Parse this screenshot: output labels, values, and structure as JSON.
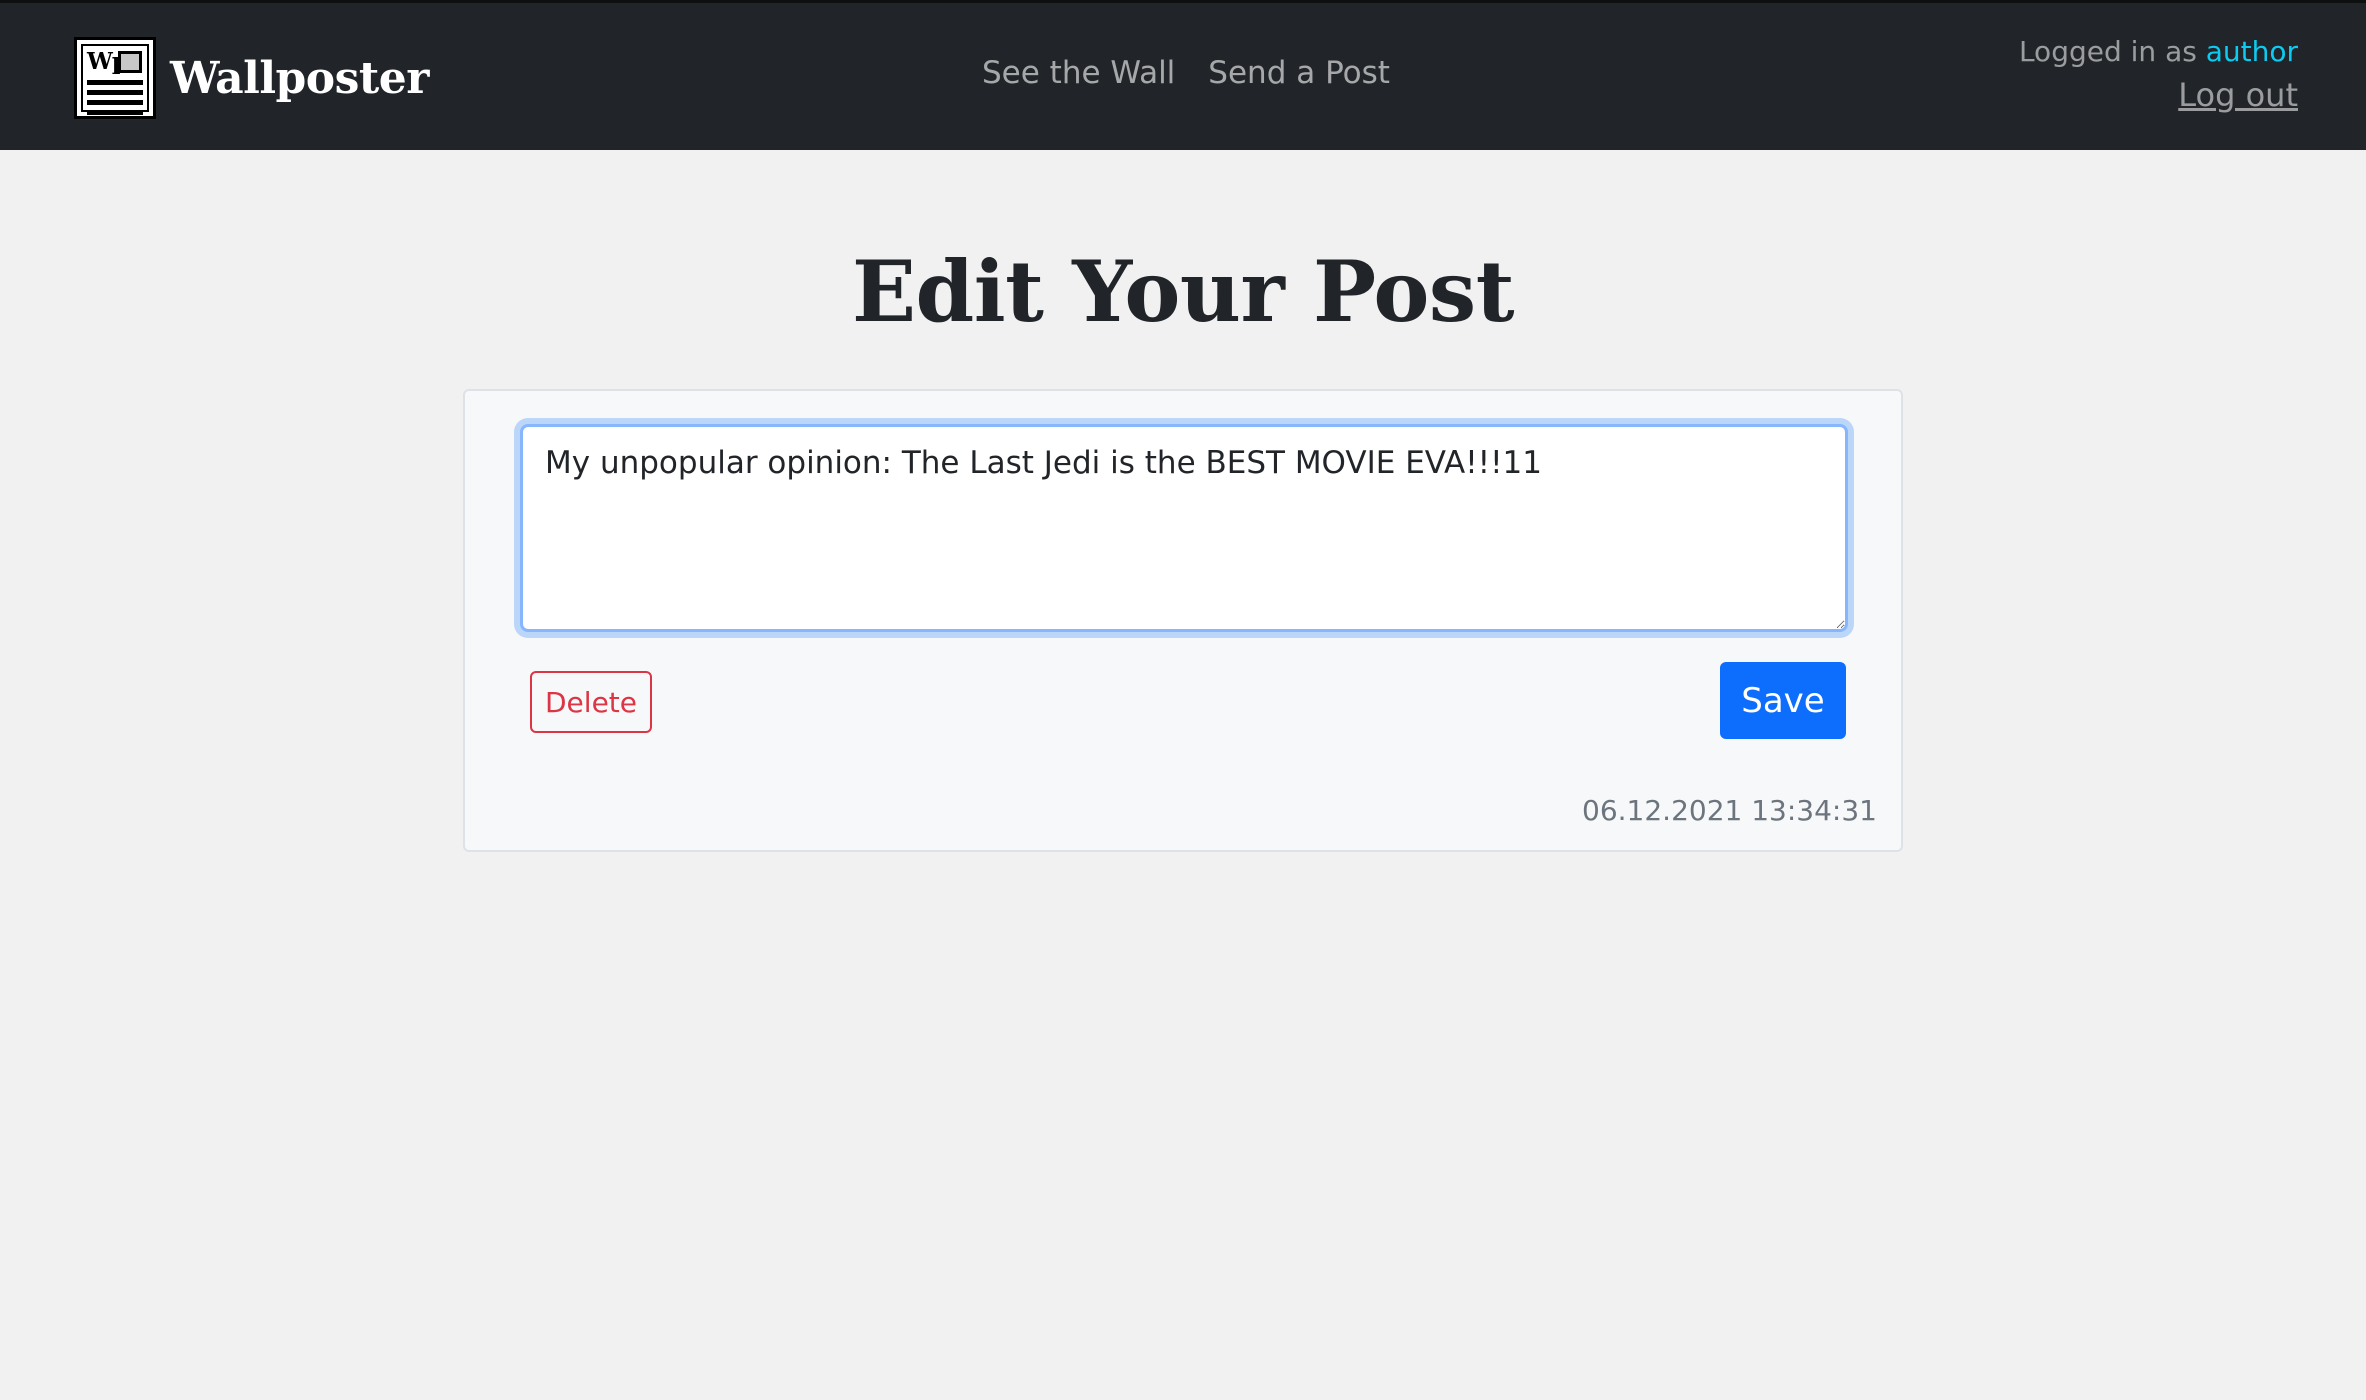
{
  "app": {
    "brand_name": "Wallposter",
    "logo_text": "Wp"
  },
  "nav": {
    "links": [
      {
        "label": "See the Wall"
      },
      {
        "label": "Send a Post"
      }
    ]
  },
  "user": {
    "logged_in_prefix": "Logged in as",
    "username": "author",
    "logout_label": "Log out"
  },
  "page": {
    "title": "Edit Your Post"
  },
  "post": {
    "content": "My unpopular opinion: The Last Jedi is the BEST MOVIE EVA!!!11",
    "delete_label": "Delete",
    "save_label": "Save",
    "timestamp": "06.12.2021 13:34:31"
  },
  "colors": {
    "navbar_bg": "#212529",
    "page_bg": "#f1f1f1",
    "accent_link": "#0dcaf0",
    "primary": "#0d6efd",
    "danger": "#dc3545",
    "muted": "#6c757d"
  },
  "icons": {
    "logo": "newspaper-logo-icon"
  }
}
